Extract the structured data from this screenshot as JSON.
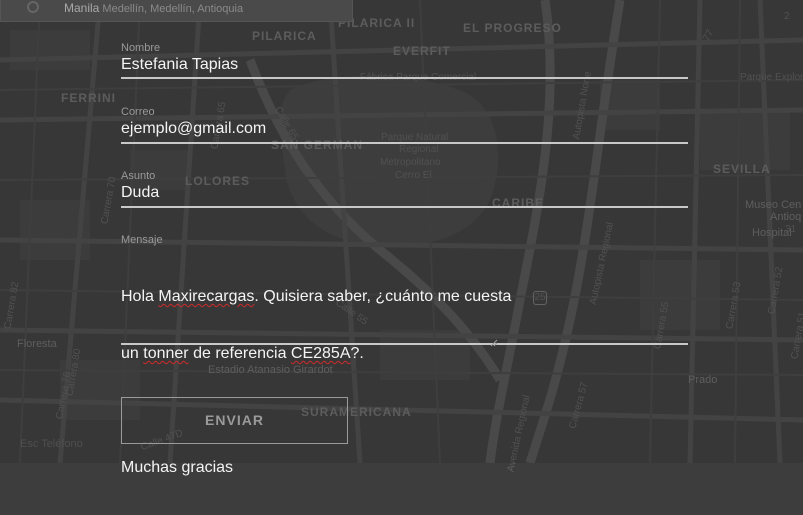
{
  "map": {
    "search": {
      "place": "Manila",
      "rest": " Medellín, Medellín, Antioquia"
    },
    "labels": {
      "pilarica": "PILARICA",
      "pilarica2": "PILARICA II",
      "el_progreso": "EL PROGRESO",
      "everfit": "EVERFIT",
      "ferrini": "FERRINI",
      "san_german": "SAN GERMAN",
      "los_colores": "LOLORES",
      "caribe": "CARIBE",
      "sevilla": "SEVILLA",
      "suramericana": "SURAMERICANA",
      "museo": "Museo Cen",
      "museo2": "Antioq",
      "hospital": "Hospital",
      "floresta": "Floresta",
      "estadio": "Estadio Atanasio Girardot",
      "prado": "Prado",
      "parque": "Parque Natural",
      "parque2": "Regional",
      "parque3": "Metropolitano",
      "parque4": "Cerro El",
      "parque_comercial": "Fábrica Parque Comercial",
      "parque_explora": "Parque Explora",
      "autopista_norte": "Autopista Norte",
      "autopista_regional": "Autopista Regional",
      "avenida_regional": "Avenida Regional",
      "calle65": "Calle 65",
      "calle55": "Calle 55",
      "carrera65": "Carrera 65",
      "carrera70": "Carrera 70",
      "carrera76": "Carrera 76",
      "carrera80": "Carrera 80",
      "carrera82": "Carrera 82",
      "carrera52": "Carrera 52",
      "carrera53": "Carrera 53",
      "carrera51": "Carrera 51",
      "carrera57": "Carrera 57",
      "carrera55": "Carrera 55",
      "calle47d": "Calle 47D",
      "route25": "25",
      "n2": "2",
      "n31": "31",
      "n77": "77"
    }
  },
  "form": {
    "nombre": {
      "label": "Nombre",
      "value": "Estefania Tapias"
    },
    "correo": {
      "label": "Correo",
      "value": "ejemplo@gmail.com"
    },
    "asunto": {
      "label": "Asunto",
      "value": "Duda"
    },
    "mensaje": {
      "label": "Mensaje",
      "line1a": "Hola ",
      "line1b": "Maxirecargas",
      "line1c": ". Quisiera saber, ¿cuánto me cuesta",
      "line2a": "un ",
      "line2b": "tonner",
      "line2c": " de referencia ",
      "line2d": "CE285A",
      "line2e": "?.",
      "line4": "Muchas gracias"
    },
    "submit_label": "ENVIAR"
  },
  "footer": {
    "corner_text": "Esc Teléfono"
  },
  "colors": {
    "background": "#3d3d3d",
    "field_line": "#c8c8c8",
    "spell_error": "#d12b2b"
  }
}
